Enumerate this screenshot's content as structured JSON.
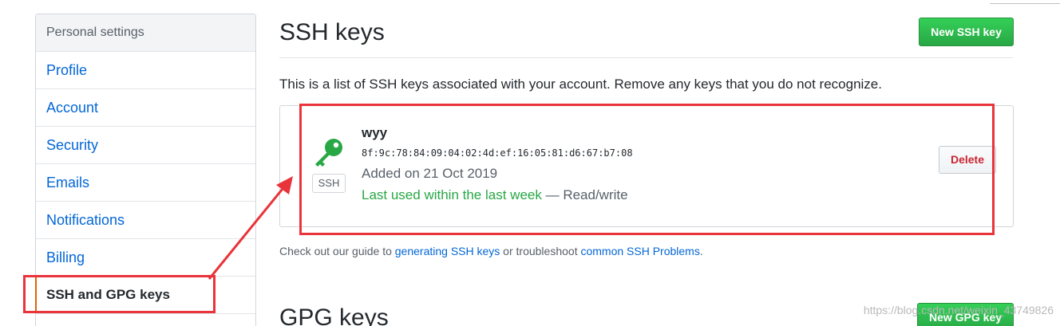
{
  "sidebar": {
    "header": "Personal settings",
    "items": [
      {
        "label": "Profile"
      },
      {
        "label": "Account"
      },
      {
        "label": "Security"
      },
      {
        "label": "Emails"
      },
      {
        "label": "Notifications"
      },
      {
        "label": "Billing"
      },
      {
        "label": "SSH and GPG keys",
        "selected": true
      }
    ]
  },
  "ssh_section": {
    "title": "SSH keys",
    "new_button": "New SSH key",
    "description": "This is a list of SSH keys associated with your account. Remove any keys that you do not recognize.",
    "key": {
      "title": "wyy",
      "fingerprint": "8f:9c:78:84:09:04:02:4d:ef:16:05:81:d6:67:b7:08",
      "type_badge": "SSH",
      "added": "Added on 21 Oct 2019",
      "last_used": "Last used within the last week",
      "access": "— Read/write",
      "delete_button": "Delete",
      "icon": "key-icon"
    },
    "guide": {
      "prefix": "Check out our guide to ",
      "link1": "generating SSH keys",
      "middle": " or troubleshoot ",
      "link2": "common SSH Problems",
      "suffix": "."
    }
  },
  "gpg_section": {
    "title": "GPG keys",
    "new_button": "New GPG key"
  },
  "watermark": "https://blog.csdn.net/weixin_43749826",
  "colors": {
    "link": "#0366d6",
    "green": "#28a745",
    "annotation_red": "#e8343a",
    "selected_marker": "#e36209"
  }
}
